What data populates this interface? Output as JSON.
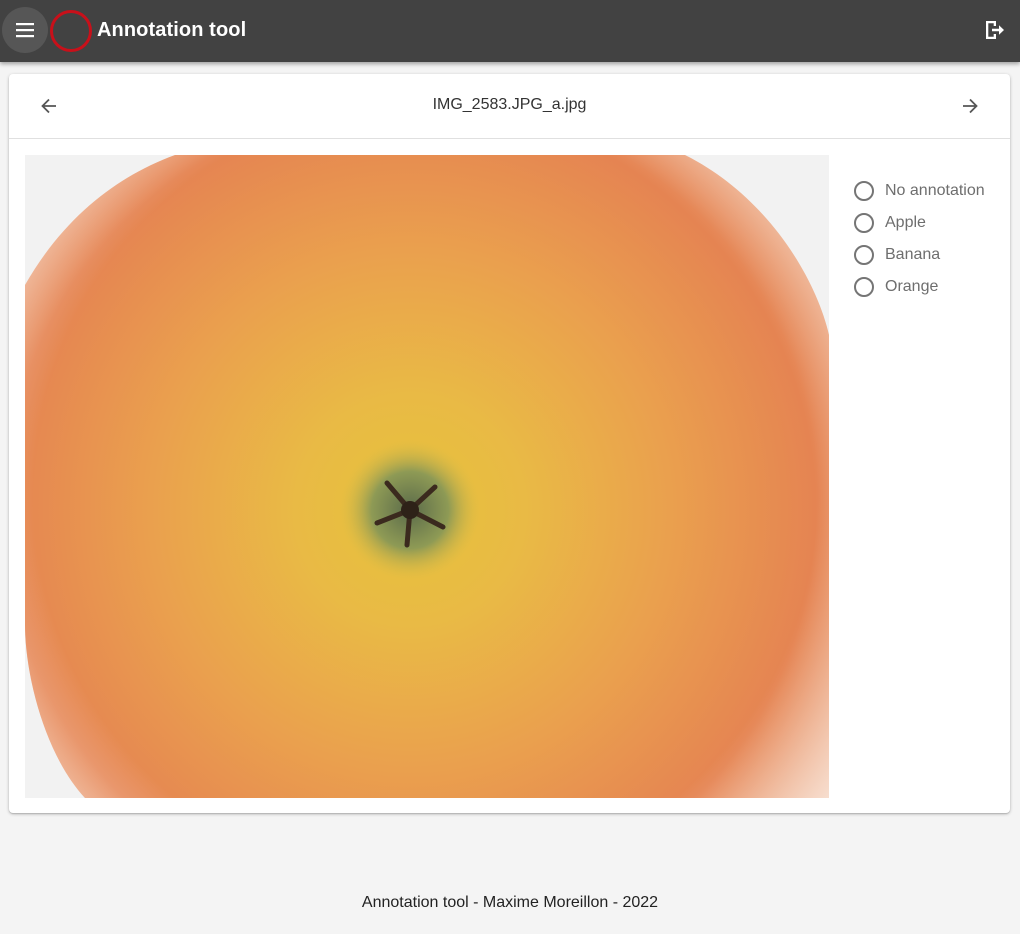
{
  "app": {
    "title": "Annotation tool",
    "brand_color": "#c8101a",
    "bar_color": "#424242"
  },
  "icons": {
    "menu": "menu-icon",
    "logout": "logout-icon",
    "prev": "arrow-left-icon",
    "next": "arrow-right-icon"
  },
  "viewer": {
    "filename": "IMG_2583.JPG_a.jpg",
    "image_alt": "apple-close-up"
  },
  "annotation": {
    "options": [
      {
        "label": "No annotation",
        "selected": false
      },
      {
        "label": "Apple",
        "selected": false
      },
      {
        "label": "Banana",
        "selected": false
      },
      {
        "label": "Orange",
        "selected": false
      }
    ]
  },
  "footer": {
    "text": "Annotation tool - Maxime Moreillon - 2022"
  }
}
